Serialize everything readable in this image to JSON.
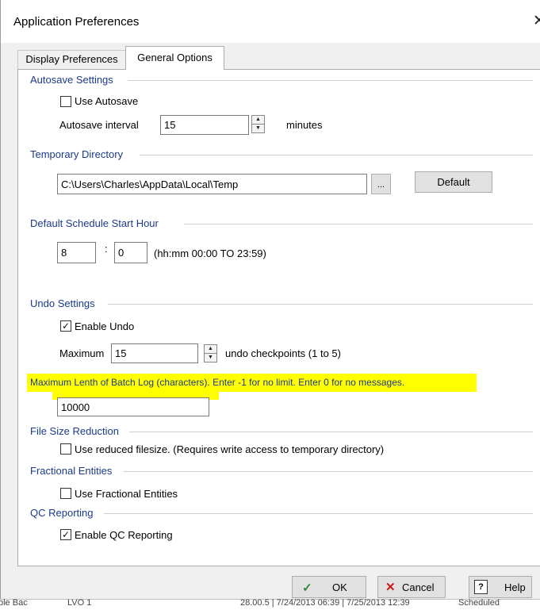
{
  "window": {
    "title": "Application Preferences",
    "close_glyph": "✕"
  },
  "tabs": [
    {
      "label": "Display Preferences"
    },
    {
      "label": "General Options"
    }
  ],
  "autosave": {
    "section_title": "Autosave Settings",
    "use_autosave_label": "Use Autosave",
    "use_autosave_checked": false,
    "interval_label": "Autosave interval",
    "interval_value": "15",
    "interval_unit": "minutes"
  },
  "temp_dir": {
    "section_title": "Temporary Directory",
    "path_value": "C:\\Users\\Charles\\AppData\\Local\\Temp",
    "browse_label": "...",
    "default_label": "Default"
  },
  "schedule": {
    "section_title": "Default Schedule Start Hour",
    "hour_value": "8",
    "separator": ":",
    "minute_value": "0",
    "hint": "(hh:mm 00:00 TO 23:59)"
  },
  "undo": {
    "section_title": "Undo Settings",
    "enable_label": "Enable Undo",
    "enable_checked": true,
    "maximum_label": "Maximum",
    "maximum_value": "15",
    "checkpoints_label": "undo checkpoints (1 to 5)"
  },
  "batch_log": {
    "label": "Maximum Lenth of Batch Log (characters). Enter -1 for  no limit. Enter 0  for no messages.",
    "value": "10000",
    "highlight_color": "#ffff00"
  },
  "file_size": {
    "section_title": "File Size Reduction",
    "label": "Use reduced filesize. (Requires write access to temporary directory)",
    "checked": false
  },
  "fractional": {
    "section_title": "Fractional Entities",
    "label": "Use Fractional Entities",
    "checked": false
  },
  "qc": {
    "section_title": "QC Reporting",
    "label": "Enable QC Reporting",
    "checked": true
  },
  "buttons": {
    "ok_label": "OK",
    "ok_icon": "✓",
    "cancel_label": "Cancel",
    "cancel_icon": "✕",
    "help_label": "Help",
    "help_icon": "?"
  },
  "colors": {
    "section_heading": "#1b3a8a",
    "ok_icon": "#2e8b2e",
    "cancel_icon": "#d01818",
    "highlight": "#ffff00"
  },
  "background_strip": {
    "left_text": "ble Bac",
    "code": "LVO 1",
    "dates": "28.00.5 | 7/24/2013 06:39 | 7/25/2013 12:39",
    "status": "Scheduled"
  }
}
